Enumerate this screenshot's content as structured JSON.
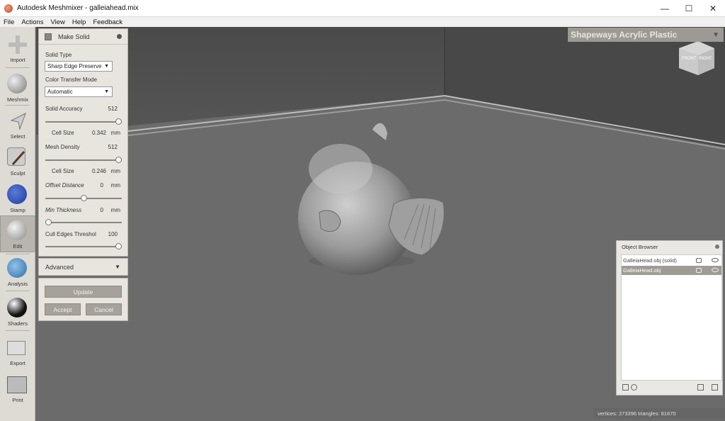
{
  "window": {
    "title": "Autodesk Meshmixer - galleiahead.mix",
    "minimize": "—",
    "maximize": "☐",
    "close": "✕"
  },
  "menu": [
    "File",
    "Actions",
    "View",
    "Help",
    "Feedback"
  ],
  "toolbar": [
    {
      "label": "Import",
      "icon": "plus-icon"
    },
    {
      "label": "Meshmix",
      "icon": "meshmix-sphere-icon"
    },
    {
      "label": "Select",
      "icon": "cursor-arrow-icon"
    },
    {
      "label": "Sculpt",
      "icon": "brush-icon"
    },
    {
      "label": "Stamp",
      "icon": "stamp-icon"
    },
    {
      "label": "Edit",
      "icon": "edit-sphere-icon"
    },
    {
      "label": "Analysis",
      "icon": "analysis-mesh-icon"
    },
    {
      "label": "Shaders",
      "icon": "shader-sphere-icon"
    },
    {
      "label": "Export",
      "icon": "export-icon"
    },
    {
      "label": "Print",
      "icon": "printer-icon"
    }
  ],
  "make_solid": {
    "title": "Make Solid",
    "solid_type_label": "Solid Type",
    "solid_type_value": "Sharp Edge Preserve",
    "color_transfer_label": "Color Transfer Mode",
    "color_transfer_value": "Automatic",
    "solid_accuracy_label": "Solid Accuracy",
    "solid_accuracy_value": "512",
    "solid_accuracy_fraction": 1.0,
    "cell_size_label": "Cell Size",
    "cell_size_1_value": "0.342",
    "mm": "mm",
    "mesh_density_label": "Mesh Density",
    "mesh_density_value": "512",
    "mesh_density_fraction": 1.0,
    "cell_size_2_value": "0.246",
    "offset_distance_label": "Offset Distance",
    "offset_distance_value": "0",
    "offset_distance_fraction": 0.5,
    "min_thickness_label": "Min Thickness",
    "min_thickness_value": "0",
    "min_thickness_fraction": 0.0,
    "cull_edges_label": "Cull Edges Threshol",
    "cull_edges_value": "100",
    "cull_edges_fraction": 1.0,
    "advanced_label": "Advanced",
    "update_label": "Update",
    "accept_label": "Accept",
    "cancel_label": "Cancel"
  },
  "material": {
    "label": "Shapeways Acrylic Plastic"
  },
  "view_cube": {
    "front": "FRONT",
    "right": "RIGHT"
  },
  "object_browser": {
    "title": "Object Browser",
    "items": [
      {
        "name": "GalleiaHead.obj (solid)",
        "selected": false
      },
      {
        "name": "GalleiaHead.obj",
        "selected": true
      }
    ]
  },
  "status": {
    "text": "vertices: 273396  triangles: 81670"
  },
  "colors": {
    "floor": "#6a6a6a",
    "wall": "#4a4a4a",
    "panel": "#e8e5df",
    "button": "#a6a29b"
  }
}
